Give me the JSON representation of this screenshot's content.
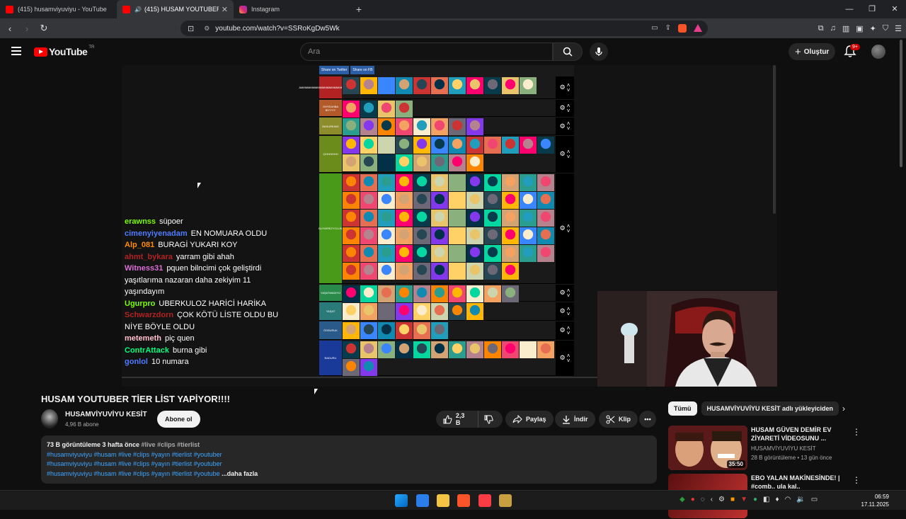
{
  "browser": {
    "tabs": [
      {
        "title": "(415) husamviyuviyu - YouTube",
        "icon": "youtube-icon"
      },
      {
        "title": "(415) HUSAM YOUTUBER TİER",
        "icon": "youtube-icon",
        "active": true
      },
      {
        "title": "Instagram",
        "icon": "instagram-icon"
      }
    ],
    "url": "youtube.com/watch?v=SSRoKgDw5Wk"
  },
  "youtube": {
    "logo_text": "YouTube",
    "region": "TR",
    "search_placeholder": "Ara",
    "create_label": "Oluştur",
    "notifications_badge": "9+"
  },
  "chat": [
    {
      "user": "erawnss",
      "color": "#7cfc00",
      "text": "süpoer"
    },
    {
      "user": "cimenyiyenadam",
      "color": "#4f7cff",
      "text": "EN NOMUARA OLDU"
    },
    {
      "user": "Alp_081",
      "color": "#ff8c00",
      "text": "BURAGİ YUKARI KOY"
    },
    {
      "user": "ahmt_bykara",
      "color": "#b22222",
      "text": "yarram gibi ahah"
    },
    {
      "user": "Witness31",
      "color": "#da70d6",
      "text": "pquen bilncimi çok geliştirdi yaşıtlarıma nazaran daha zekiyim 11 yaşındayım"
    },
    {
      "user": "Ugurpro",
      "color": "#7cfc00",
      "text": "UBERKULOZ HARİCİ HARİKA"
    },
    {
      "user": "Schwarzdorn",
      "color": "#b22222",
      "text": "ÇOK KÖTÜ LİSTE OLDU BU NİYE BÖYLE OLDU"
    },
    {
      "user": "metemeth",
      "color": "#ffc0cb",
      "text": "piç quen"
    },
    {
      "user": "ContrAttack",
      "color": "#00ff7f",
      "text": "burna gibi"
    },
    {
      "user": "gonlol",
      "color": "#4f7cff",
      "text": "10 numara"
    }
  ],
  "tierlist": {
    "share_buttons": [
      "Share on Twitter",
      "Share on FB"
    ],
    "tiers": [
      {
        "label": "AMMMMMMMMMMMMMMMMMMMMMMMMMM",
        "color": "#b22222",
        "count": 11
      },
      {
        "label": "OHYEAHBA BIYYYY",
        "color": "#b35a2a",
        "count": 4
      },
      {
        "label": "BASURKING",
        "color": "#8c8c2a",
        "count": 8
      },
      {
        "label": "ÇİHHHHHH",
        "color": "#6b8c1a",
        "count": 20
      },
      {
        "label": "DUYARSIZYOLUM",
        "color": "#4a9a1a",
        "count": 70
      },
      {
        "label": "YAŞATMADIYÜ",
        "color": "#2a8a4a",
        "count": 10
      },
      {
        "label": "YAŞAT",
        "color": "#2a7a7a",
        "count": 8
      },
      {
        "label": "ÖSSURUK",
        "color": "#2a5a8a",
        "count": 6
      },
      {
        "label": "BADURU",
        "color": "#1a3a9a",
        "count": 14
      }
    ]
  },
  "video": {
    "title": "HUSAM YOUTUBER TİER LİST YAPİYOR!!!!",
    "channel": "HUSAMVİYUVİYU KESİT",
    "subscribers": "4,96 B abone",
    "subscribe_label": "Abone ol",
    "likes": "2,3 B",
    "share_label": "Paylaş",
    "download_label": "İndir",
    "clip_label": "Klip",
    "description": {
      "meta": "73 B görüntüleme  3 hafta önce",
      "meta_tags": "#live #clips #tierlist",
      "lines": [
        "#husamviyuviyu #husam #live #clips #yayın #tierlist #youtuber",
        "#husamviyuviyu #husam #live #clips #yayın #tierlist #youtuber",
        "#husamviyuviyu #husam #live #clips #yayın #tierlist #youtube"
      ],
      "more": "...daha fazla"
    }
  },
  "sidebar": {
    "chips": [
      "Tümü",
      "HUSAMVİYUVİYU KESİT adlı yükleyiciden"
    ],
    "recommendations": [
      {
        "title": "HUSAM GÜVEN DEMİR EV ZİYARETİ VİDEOSUNU ...",
        "channel": "HUSAMVİYUVİYU KESİT",
        "views": "28 B görüntüleme • 13 gün önce",
        "duration": "35:50"
      },
      {
        "title": "EBO YALAN MAKİNESİNDE! | #comb.. ula kal..",
        "channel": "",
        "views": "",
        "duration": ""
      }
    ]
  },
  "taskbar": {
    "time": "06:59",
    "date": "17.11.2025"
  }
}
